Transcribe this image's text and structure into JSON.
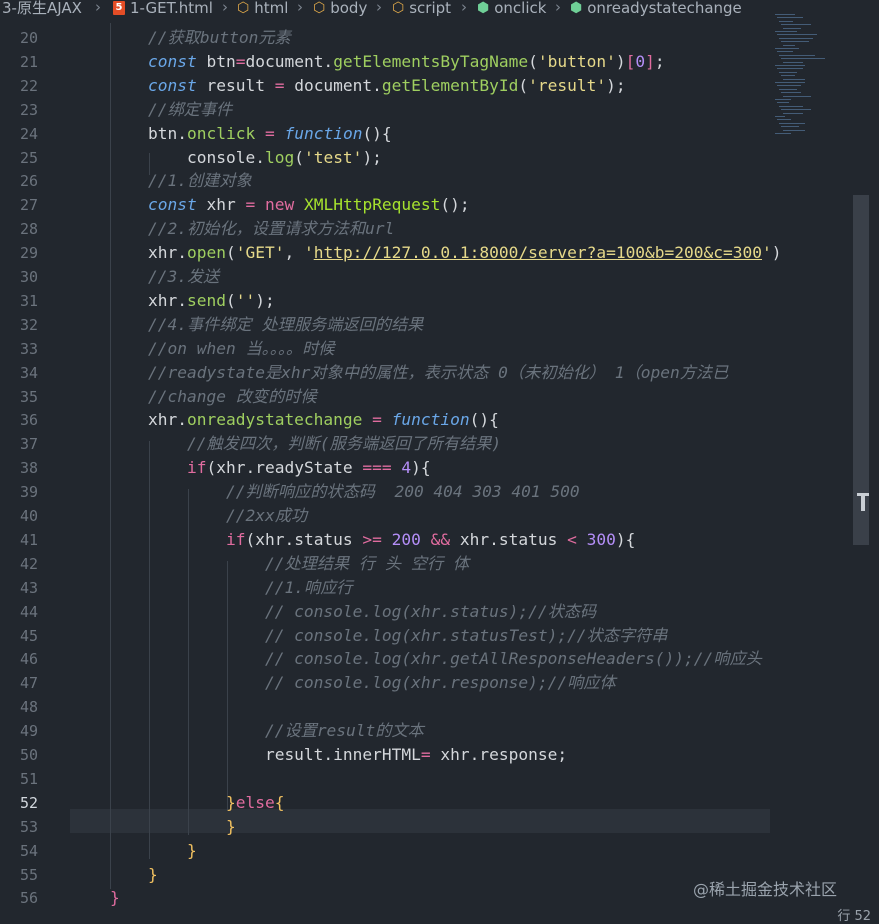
{
  "breadcrumb": {
    "items": [
      "3-原生AJAX",
      "1-GET.html",
      "html",
      "body",
      "script",
      "onclick",
      "onreadystatechange"
    ],
    "html_badge": "5"
  },
  "editor": {
    "lines": [
      {
        "n": "20",
        "tokens": [
          [
            "cm",
            "//获取button元素"
          ]
        ]
      },
      {
        "n": "21",
        "tokens": [
          [
            "kw",
            "const"
          ],
          [
            "var",
            " btn"
          ],
          [
            "op",
            "="
          ],
          [
            "var",
            "document."
          ],
          [
            "fn",
            "getElementsByTagName"
          ],
          [
            "var",
            "("
          ],
          [
            "str",
            "'button'"
          ],
          [
            "var",
            ")"
          ],
          [
            "op",
            "["
          ],
          [
            "num",
            "0"
          ],
          [
            "op",
            "]"
          ],
          [
            "var",
            ";"
          ]
        ]
      },
      {
        "n": "22",
        "tokens": [
          [
            "kw",
            "const"
          ],
          [
            "var",
            " result "
          ],
          [
            "op",
            "="
          ],
          [
            "var",
            " document."
          ],
          [
            "fn",
            "getElementById"
          ],
          [
            "var",
            "("
          ],
          [
            "str",
            "'result'"
          ],
          [
            "var",
            ");"
          ]
        ]
      },
      {
        "n": "23",
        "tokens": [
          [
            "cm",
            "//绑定事件"
          ]
        ]
      },
      {
        "n": "24",
        "tokens": [
          [
            "var",
            "btn."
          ],
          [
            "fn",
            "onclick"
          ],
          [
            "var",
            " "
          ],
          [
            "op",
            "="
          ],
          [
            "var",
            " "
          ],
          [
            "kw",
            "function"
          ],
          [
            "var",
            "(){"
          ]
        ]
      },
      {
        "n": "25",
        "tokens": [
          [
            "var",
            "    console."
          ],
          [
            "fn",
            "log"
          ],
          [
            "var",
            "("
          ],
          [
            "str",
            "'test'"
          ],
          [
            "var",
            ");"
          ]
        ]
      },
      {
        "n": "26",
        "tokens": [
          [
            "cm",
            "//1.创建对象"
          ]
        ]
      },
      {
        "n": "27",
        "tokens": [
          [
            "kw",
            "const"
          ],
          [
            "var",
            " xhr "
          ],
          [
            "op",
            "="
          ],
          [
            "var",
            " "
          ],
          [
            "nw",
            "new"
          ],
          [
            "var",
            " "
          ],
          [
            "cls",
            "XMLHttpRequest"
          ],
          [
            "var",
            "();"
          ]
        ]
      },
      {
        "n": "28",
        "tokens": [
          [
            "cm",
            "//2.初始化，设置请求方法和url"
          ]
        ]
      },
      {
        "n": "29",
        "tokens": [
          [
            "var",
            "xhr."
          ],
          [
            "fn",
            "open"
          ],
          [
            "var",
            "("
          ],
          [
            "str",
            "'GET'"
          ],
          [
            "var",
            ", "
          ],
          [
            "str",
            "'"
          ],
          [
            "url",
            "http://127.0.0.1:8000/server?a=100&b=200&c=300"
          ],
          [
            "str",
            "'"
          ],
          [
            "var",
            ")"
          ]
        ]
      },
      {
        "n": "30",
        "tokens": [
          [
            "cm",
            "//3.发送"
          ]
        ]
      },
      {
        "n": "31",
        "tokens": [
          [
            "var",
            "xhr."
          ],
          [
            "fn",
            "send"
          ],
          [
            "var",
            "("
          ],
          [
            "str",
            "''"
          ],
          [
            "var",
            ");"
          ]
        ]
      },
      {
        "n": "32",
        "tokens": [
          [
            "cm",
            "//4.事件绑定 处理服务端返回的结果"
          ]
        ]
      },
      {
        "n": "33",
        "tokens": [
          [
            "cm",
            "//on when 当。。。。时候"
          ]
        ]
      },
      {
        "n": "34",
        "tokens": [
          [
            "cm",
            "//readystate是xhr对象中的属性，表示状态 0（未初始化） 1（open方法已"
          ]
        ]
      },
      {
        "n": "35",
        "tokens": [
          [
            "cm",
            "//change 改变的时候"
          ]
        ]
      },
      {
        "n": "36",
        "tokens": [
          [
            "var",
            "xhr."
          ],
          [
            "fn",
            "onreadystatechange"
          ],
          [
            "var",
            " "
          ],
          [
            "op",
            "="
          ],
          [
            "var",
            " "
          ],
          [
            "kw",
            "function"
          ],
          [
            "var",
            "(){"
          ]
        ]
      },
      {
        "n": "37",
        "tokens": [
          [
            "cm",
            "    //触发四次，判断(服务端返回了所有结果)"
          ]
        ]
      },
      {
        "n": "38",
        "tokens": [
          [
            "var",
            "    "
          ],
          [
            "nw",
            "if"
          ],
          [
            "var",
            "(xhr.readyState "
          ],
          [
            "op",
            "==="
          ],
          [
            "var",
            " "
          ],
          [
            "num",
            "4"
          ],
          [
            "var",
            "){"
          ]
        ]
      },
      {
        "n": "39",
        "tokens": [
          [
            "cm",
            "        //判断响应的状态码  200 404 303 401 500"
          ]
        ]
      },
      {
        "n": "40",
        "tokens": [
          [
            "cm",
            "        //2xx成功"
          ]
        ]
      },
      {
        "n": "41",
        "tokens": [
          [
            "var",
            "        "
          ],
          [
            "nw",
            "if"
          ],
          [
            "var",
            "(xhr.status "
          ],
          [
            "op",
            ">="
          ],
          [
            "var",
            " "
          ],
          [
            "num",
            "200"
          ],
          [
            "var",
            " "
          ],
          [
            "op",
            "&&"
          ],
          [
            "var",
            " xhr.status "
          ],
          [
            "op",
            "<"
          ],
          [
            "var",
            " "
          ],
          [
            "num",
            "300"
          ],
          [
            "var",
            "){"
          ]
        ]
      },
      {
        "n": "42",
        "tokens": [
          [
            "cm",
            "            //处理结果 行 头 空行 体"
          ]
        ]
      },
      {
        "n": "43",
        "tokens": [
          [
            "cm",
            "            //1.响应行"
          ]
        ]
      },
      {
        "n": "44",
        "tokens": [
          [
            "cm",
            "            // console.log(xhr.status);//状态码"
          ]
        ]
      },
      {
        "n": "45",
        "tokens": [
          [
            "cm",
            "            // console.log(xhr.statusTest);//状态字符串"
          ]
        ]
      },
      {
        "n": "46",
        "tokens": [
          [
            "cm",
            "            // console.log(xhr.getAllResponseHeaders());//响应头"
          ]
        ]
      },
      {
        "n": "47",
        "tokens": [
          [
            "cm",
            "            // console.log(xhr.response);//响应体"
          ]
        ]
      },
      {
        "n": "48",
        "tokens": []
      },
      {
        "n": "49",
        "tokens": [
          [
            "cm",
            "            //设置result的文本"
          ]
        ]
      },
      {
        "n": "50",
        "tokens": [
          [
            "var",
            "            result.innerHTML"
          ],
          [
            "op",
            "="
          ],
          [
            "var",
            " xhr.response;"
          ]
        ]
      },
      {
        "n": "51",
        "tokens": []
      },
      {
        "n": "52",
        "tokens": [
          [
            "var",
            "        "
          ],
          [
            "ptn",
            "}"
          ],
          [
            "nw",
            "else"
          ],
          [
            "ptn",
            "{"
          ]
        ]
      },
      {
        "n": "53",
        "tokens": [
          [
            "var",
            "        "
          ],
          [
            "ptn",
            "}"
          ]
        ]
      },
      {
        "n": "54",
        "tokens": [
          [
            "var",
            "    "
          ],
          [
            "ptn",
            "}"
          ]
        ]
      },
      {
        "n": "55",
        "tokens": [
          [
            "ptn",
            "}"
          ]
        ]
      },
      {
        "n": "56",
        "tokens": [
          [
            "nw",
            "}"
          ]
        ]
      }
    ],
    "current_line": "52"
  },
  "status": {
    "position": "行 52"
  },
  "watermark": "@稀土掘金技术社区",
  "colors": {
    "background": "#22272e",
    "comment": "#6a737d",
    "keyword": "#6aa7e8",
    "string": "#e6d98a",
    "number": "#b48ef7",
    "function": "#9fcf60",
    "operator": "#e06c9f"
  }
}
